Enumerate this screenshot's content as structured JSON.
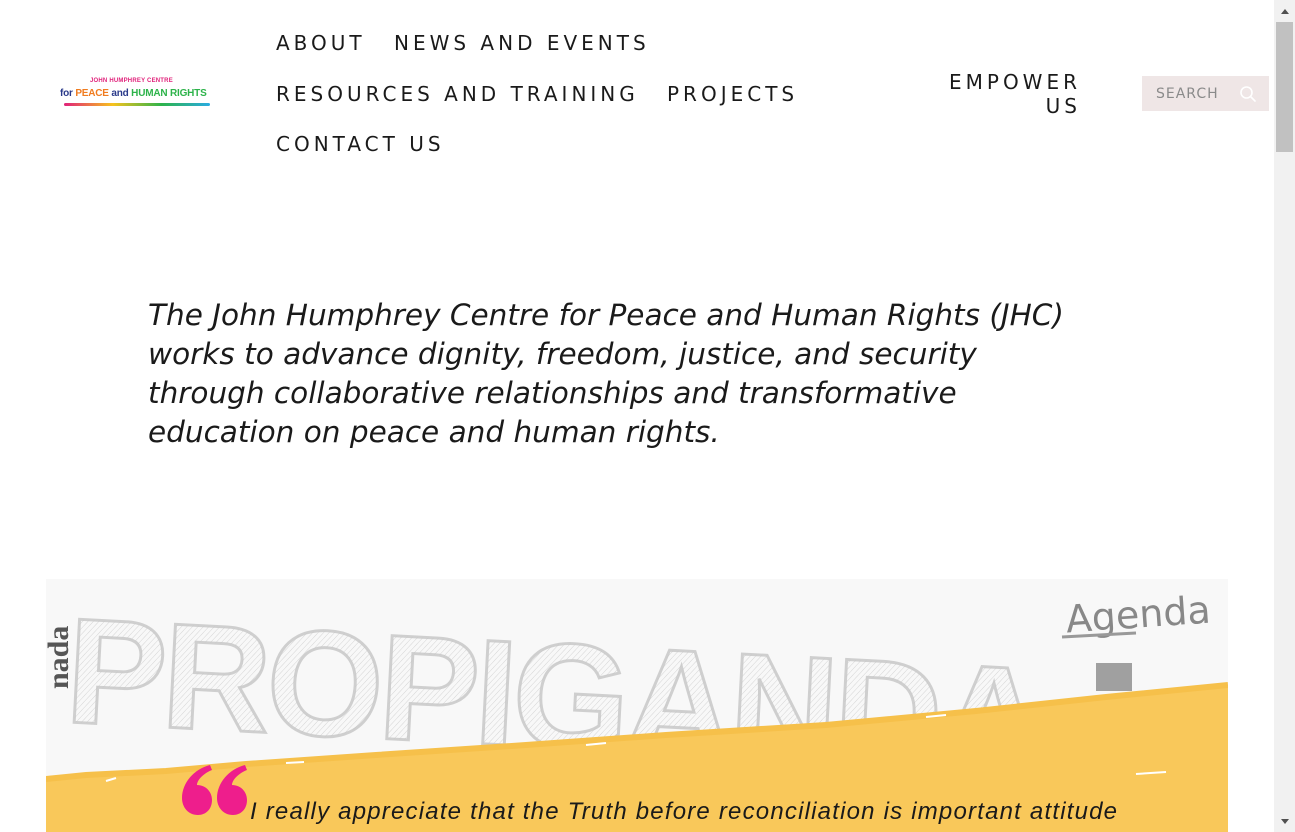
{
  "header": {
    "logo": {
      "line1": "JOHN HUMPHREY CENTRE",
      "line2_for": "for",
      "line2_peace": "PEACE",
      "line2_and": "and",
      "line2_hr": "HUMAN RIGHTS"
    },
    "nav": {
      "about": "ABOUT",
      "news": "NEWS AND EVENTS",
      "resources": "RESOURCES AND TRAINING",
      "projects": "PROJECTS",
      "contact": "CONTACT US"
    },
    "empower_line1": "EMPOWER",
    "empower_line2": "US",
    "search": {
      "placeholder": "SEARCH"
    }
  },
  "main": {
    "mission": "The John Humphrey Centre for Peace and Human Rights (JHC) works to advance dignity, freedom, justice, and security through collaborative relationships and transformative education on peace and human rights."
  },
  "banner": {
    "art_text": "PROPAGANDA",
    "agenda": "Agenda",
    "side_text": "nada",
    "quote": "I really appreciate that the Truth before reconciliation is important attitude and a important step to learn",
    "colors": {
      "accent_yellow": "#f9c85a",
      "quote_mark": "#ee1e8c"
    }
  },
  "icons": {
    "search": "search-icon",
    "quote": "quote-mark-icon"
  }
}
